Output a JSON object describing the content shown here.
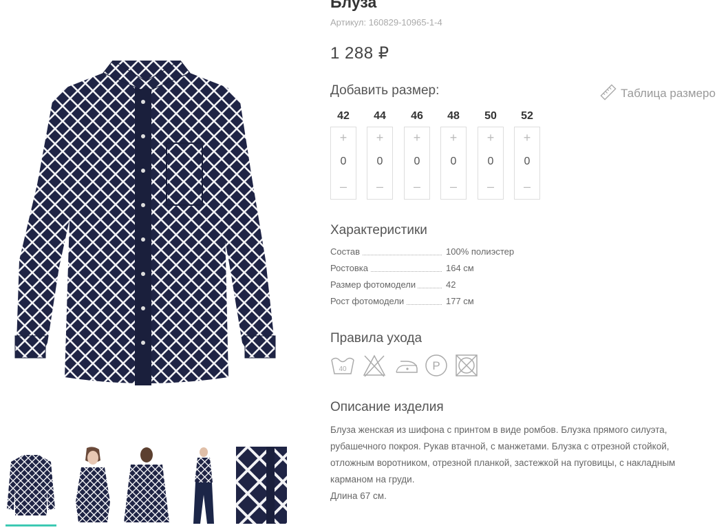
{
  "product": {
    "title": "Блуза",
    "sku_label": "Артикул:",
    "sku": "160829-10965-1-4",
    "price": "1 288 ₽"
  },
  "sizes": {
    "heading": "Добавить размер:",
    "size_table_link": "Таблица размеро",
    "items": [
      {
        "size": "42",
        "plus": "+",
        "qty": "0",
        "minus": "–"
      },
      {
        "size": "44",
        "plus": "+",
        "qty": "0",
        "minus": "–"
      },
      {
        "size": "46",
        "plus": "+",
        "qty": "0",
        "minus": "–"
      },
      {
        "size": "48",
        "plus": "+",
        "qty": "0",
        "minus": "–"
      },
      {
        "size": "50",
        "plus": "+",
        "qty": "0",
        "minus": "–"
      },
      {
        "size": "52",
        "plus": "+",
        "qty": "0",
        "minus": "–"
      }
    ]
  },
  "characteristics": {
    "heading": "Характеристики",
    "rows": [
      {
        "name": "Состав",
        "value": "100% полиэстер"
      },
      {
        "name": "Ростовка",
        "value": "164 см"
      },
      {
        "name": "Размер фотомодели",
        "value": "42"
      },
      {
        "name": "Рост фотомодели",
        "value": "177 см"
      }
    ]
  },
  "care": {
    "heading": "Правила ухода",
    "wash_temp": "40",
    "dry_clean_letter": "P",
    "icons": [
      "wash-40-icon",
      "no-bleach-icon",
      "iron-low-icon",
      "dry-clean-p-icon",
      "no-tumble-dry-icon"
    ]
  },
  "description": {
    "heading": "Описание изделия",
    "text": "Блуза женская из шифона с принтом в виде ромбов. Блузка прямого силуэта, рубашечного покроя. Рукав втачной, с манжетами. Блузка с отрезной стойкой, отложным воротником, отрезной планкой, застежкой на пуговицы, с накладным карманом на груди.",
    "length": "Длина 67 см."
  },
  "gallery": {
    "thumbnails": [
      "thumb-blouse-flat",
      "thumb-model-front",
      "thumb-blouse-back",
      "thumb-model-full",
      "thumb-fabric-closeup"
    ],
    "active_index": 0
  },
  "colors": {
    "navy": "#1f2445",
    "accent": "#3dc9b3"
  }
}
